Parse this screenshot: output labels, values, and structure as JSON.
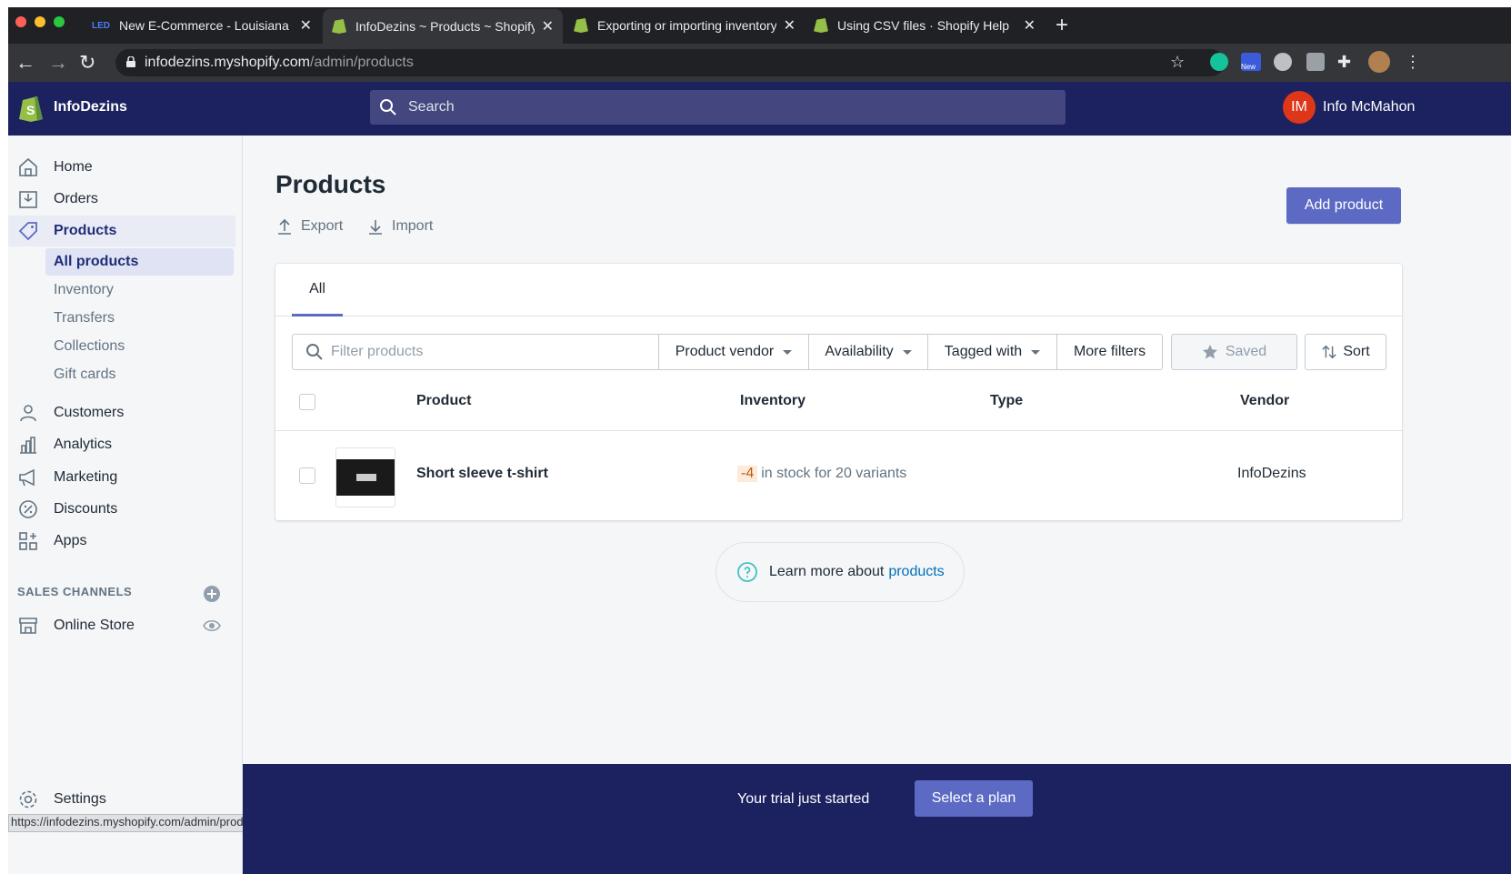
{
  "browser": {
    "tabs": [
      {
        "label": "New E-Commerce - Louisiana"
      },
      {
        "label": "InfoDezins ~ Products ~ Shopify"
      },
      {
        "label": "Exporting or importing inventory"
      },
      {
        "label": "Using CSV files · Shopify Help"
      }
    ],
    "url_host": "infodezins.myshopify.com",
    "url_path": "/admin/products",
    "status_url": "https://infodezins.myshopify.com/admin/products",
    "ext_badge": "New"
  },
  "topbar": {
    "store_name": "InfoDezins",
    "search_placeholder": "Search",
    "user_initials": "IM",
    "user_name": "Info McMahon"
  },
  "sidebar": {
    "items": [
      {
        "label": "Home",
        "icon": "home-icon"
      },
      {
        "label": "Orders",
        "icon": "orders-icon"
      },
      {
        "label": "Products",
        "icon": "tag-icon"
      }
    ],
    "sub_items": [
      {
        "label": "All products"
      },
      {
        "label": "Inventory"
      },
      {
        "label": "Transfers"
      },
      {
        "label": "Collections"
      },
      {
        "label": "Gift cards"
      }
    ],
    "items2": [
      {
        "label": "Customers",
        "icon": "customers-icon"
      },
      {
        "label": "Analytics",
        "icon": "analytics-icon"
      },
      {
        "label": "Marketing",
        "icon": "marketing-icon"
      },
      {
        "label": "Discounts",
        "icon": "discounts-icon"
      },
      {
        "label": "Apps",
        "icon": "apps-icon"
      }
    ],
    "sales_channels_label": "SALES CHANNELS",
    "online_store": "Online Store",
    "settings": "Settings"
  },
  "main": {
    "title": "Products",
    "export_label": "Export",
    "import_label": "Import",
    "add_product_label": "Add product",
    "tab_all": "All",
    "filter_placeholder": "Filter products",
    "filters": {
      "vendor": "Product vendor",
      "availability": "Availability",
      "tagged": "Tagged with",
      "more": "More filters",
      "saved": "Saved",
      "sort": "Sort"
    },
    "columns": {
      "product": "Product",
      "inventory": "Inventory",
      "type": "Type",
      "vendor": "Vendor"
    },
    "rows": [
      {
        "product": "Short sleeve t-shirt",
        "inventory_count": "-4",
        "inventory_text": "in stock for 20 variants",
        "type": "",
        "vendor": "InfoDezins"
      }
    ],
    "learn_text": "Learn more about",
    "learn_link": "products"
  },
  "trial": {
    "text": "Your trial just started",
    "button": "Select a plan"
  },
  "colors": {
    "topbar": "#1c2260",
    "accent": "#5c6ac4",
    "sidebar_bg": "#f4f6f8"
  }
}
